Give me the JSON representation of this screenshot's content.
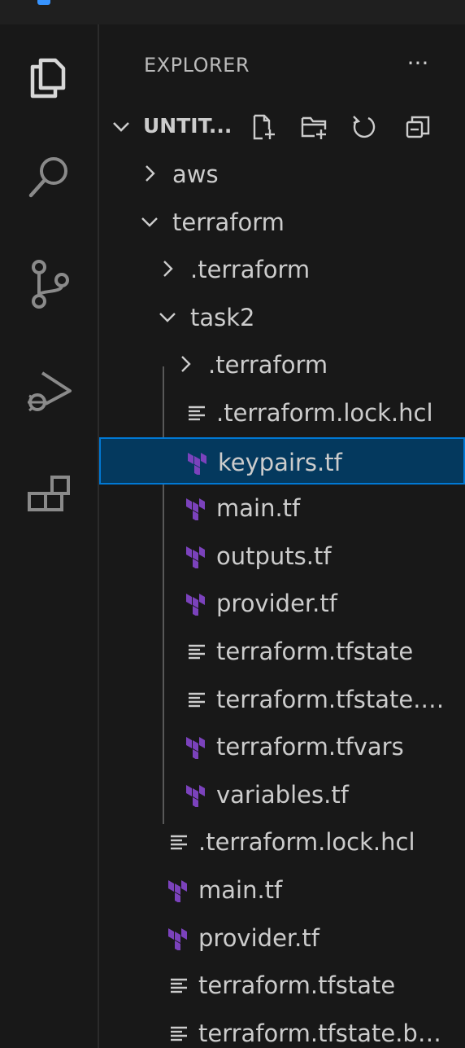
{
  "activity_bar": {
    "items": [
      {
        "name": "explorer",
        "icon": "files-icon"
      },
      {
        "name": "search",
        "icon": "search-icon"
      },
      {
        "name": "source-control",
        "icon": "source-control-icon"
      },
      {
        "name": "run-and-debug",
        "icon": "run-debug-icon"
      },
      {
        "name": "extensions",
        "icon": "extensions-icon"
      }
    ]
  },
  "sidebar": {
    "title": "EXPLORER",
    "more_label": "···",
    "section": {
      "label": "UNTIT...",
      "actions": [
        "new-file-icon",
        "new-folder-icon",
        "refresh-icon",
        "collapse-all-icon"
      ]
    },
    "tree": [
      {
        "label": "aws",
        "type": "folder",
        "expanded": false
      },
      {
        "label": "terraform",
        "type": "folder",
        "expanded": true
      },
      {
        "label": ".terraform",
        "type": "folder",
        "expanded": false
      },
      {
        "label": "task2",
        "type": "folder",
        "expanded": true
      },
      {
        "label": ".terraform",
        "type": "folder",
        "expanded": false
      },
      {
        "label": ".terraform.lock.hcl",
        "type": "text"
      },
      {
        "label": "keypairs.tf",
        "type": "terraform",
        "selected": true
      },
      {
        "label": "main.tf",
        "type": "terraform"
      },
      {
        "label": "outputs.tf",
        "type": "terraform"
      },
      {
        "label": "provider.tf",
        "type": "terraform"
      },
      {
        "label": "terraform.tfstate",
        "type": "text"
      },
      {
        "label": "terraform.tfstate.…",
        "type": "text"
      },
      {
        "label": "terraform.tfvars",
        "type": "terraform"
      },
      {
        "label": "variables.tf",
        "type": "terraform"
      },
      {
        "label": ".terraform.lock.hcl",
        "type": "text"
      },
      {
        "label": "main.tf",
        "type": "terraform"
      },
      {
        "label": "provider.tf",
        "type": "terraform"
      },
      {
        "label": "terraform.tfstate",
        "type": "text"
      },
      {
        "label": "terraform.tfstate.b…",
        "type": "text"
      }
    ]
  },
  "colors": {
    "background": "#181818",
    "selection_bg": "#04395e",
    "selection_border": "#0078d4",
    "terraform_icon": "#7b42bc",
    "text": "#cccccc"
  }
}
